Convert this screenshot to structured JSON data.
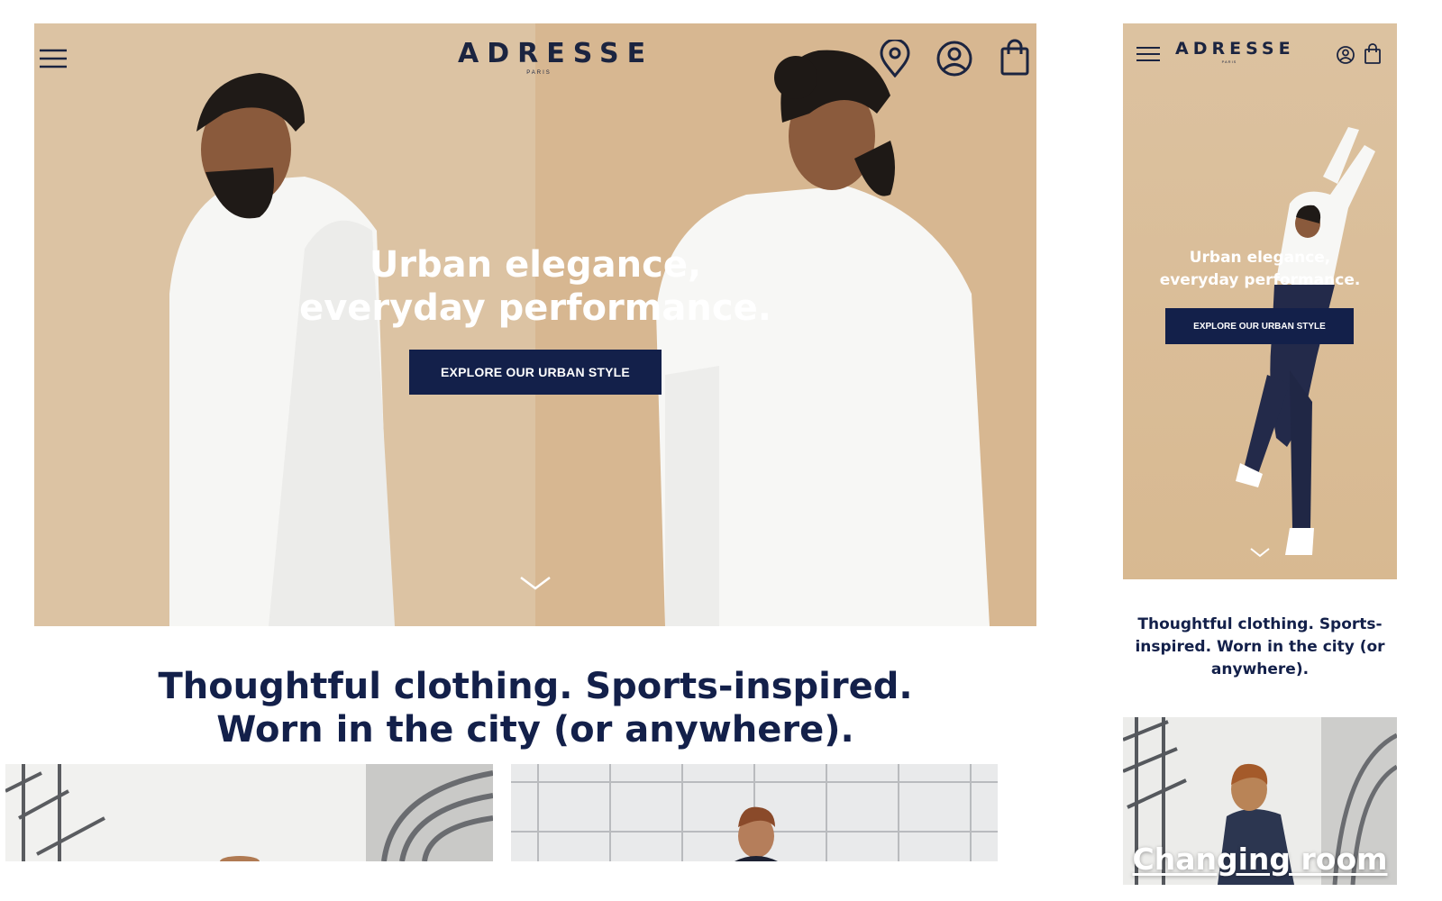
{
  "brand": {
    "logo_text": "ADRESSE",
    "logo_sub": "PARIS"
  },
  "colors": {
    "navy": "#13204a",
    "hero_beige": "#d9bc98",
    "white_shirt": "#ffffff"
  },
  "icons": {
    "menu": "hamburger-menu-icon",
    "location": "location-pin-icon",
    "account": "user-account-icon",
    "bag": "shopping-bag-icon",
    "scroll": "chevron-down-icon"
  },
  "desktop": {
    "hero": {
      "title_line1": "Urban elegance,",
      "title_line2": "everyday performance.",
      "cta_label": "EXPLORE OUR URBAN STYLE"
    },
    "tagline": {
      "line1": "Thoughtful clothing. Sports-inspired.",
      "line2": "Worn in the city (or anywhere)."
    }
  },
  "mobile": {
    "hero": {
      "title_line1": "Urban elegance,",
      "title_line2": "everyday performance.",
      "cta_label": "EXPLORE OUR URBAN STYLE"
    },
    "tagline": {
      "line1": "Thoughtful clothing. Sports-",
      "line2": "inspired. Worn in the city (or",
      "line3": "anywhere)."
    },
    "card": {
      "title": "Changing room"
    }
  }
}
